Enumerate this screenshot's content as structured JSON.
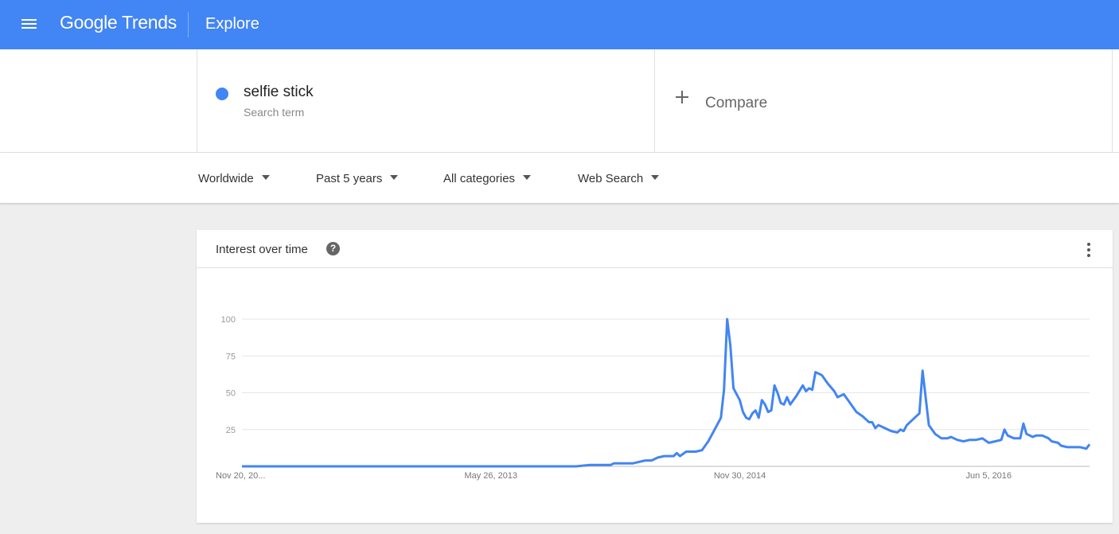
{
  "header": {
    "brand": "Google Trends",
    "section": "Explore"
  },
  "search": {
    "term": "selfie stick",
    "term_type": "Search term",
    "term_color": "#4285f4",
    "compare_label": "Compare"
  },
  "filters": {
    "region": "Worldwide",
    "time_range": "Past 5 years",
    "category": "All categories",
    "property": "Web Search"
  },
  "card": {
    "title": "Interest over time",
    "help_glyph": "?"
  },
  "colors": {
    "accent": "#4285f4"
  },
  "chart_data": {
    "type": "line",
    "title": "Interest over time",
    "xlabel": "",
    "ylabel": "",
    "ylim": [
      0,
      100
    ],
    "yticks": [
      25,
      50,
      75,
      100
    ],
    "x_range": [
      "2011-11-20",
      "2016-11-13"
    ],
    "xticks": [
      {
        "date": "2011-11-20",
        "label": "Nov 20, 20..."
      },
      {
        "date": "2013-05-26",
        "label": "May 26, 2013"
      },
      {
        "date": "2014-11-30",
        "label": "Nov 30, 2014"
      },
      {
        "date": "2016-06-05",
        "label": "Jun 5, 2016"
      }
    ],
    "grid": true,
    "legend": "none",
    "series": [
      {
        "color": "#4285f4",
        "points": [
          [
            "2011-11-20",
            0
          ],
          [
            "2012-06-01",
            0
          ],
          [
            "2013-01-01",
            0
          ],
          [
            "2013-06-01",
            0
          ],
          [
            "2013-12-01",
            0
          ],
          [
            "2014-01-01",
            1
          ],
          [
            "2014-02-16",
            1
          ],
          [
            "2014-02-23",
            2
          ],
          [
            "2014-04-06",
            2
          ],
          [
            "2014-04-20",
            3
          ],
          [
            "2014-05-04",
            4
          ],
          [
            "2014-05-18",
            4
          ],
          [
            "2014-06-01",
            6
          ],
          [
            "2014-06-15",
            7
          ],
          [
            "2014-07-06",
            7
          ],
          [
            "2014-07-13",
            9
          ],
          [
            "2014-07-20",
            7
          ],
          [
            "2014-08-03",
            10
          ],
          [
            "2014-08-24",
            10
          ],
          [
            "2014-09-07",
            11
          ],
          [
            "2014-09-21",
            17
          ],
          [
            "2014-10-05",
            25
          ],
          [
            "2014-10-19",
            33
          ],
          [
            "2014-10-26",
            52
          ],
          [
            "2014-11-02",
            100
          ],
          [
            "2014-11-09",
            82
          ],
          [
            "2014-11-16",
            53
          ],
          [
            "2014-11-30",
            45
          ],
          [
            "2014-12-07",
            37
          ],
          [
            "2014-12-14",
            33
          ],
          [
            "2014-12-21",
            32
          ],
          [
            "2014-12-28",
            36
          ],
          [
            "2015-01-04",
            38
          ],
          [
            "2015-01-11",
            33
          ],
          [
            "2015-01-18",
            45
          ],
          [
            "2015-01-25",
            42
          ],
          [
            "2015-02-01",
            37
          ],
          [
            "2015-02-08",
            38
          ],
          [
            "2015-02-15",
            55
          ],
          [
            "2015-02-22",
            50
          ],
          [
            "2015-03-01",
            43
          ],
          [
            "2015-03-08",
            42
          ],
          [
            "2015-03-15",
            47
          ],
          [
            "2015-03-22",
            42
          ],
          [
            "2015-04-05",
            48
          ],
          [
            "2015-04-19",
            55
          ],
          [
            "2015-04-26",
            51
          ],
          [
            "2015-05-03",
            53
          ],
          [
            "2015-05-10",
            52
          ],
          [
            "2015-05-17",
            64
          ],
          [
            "2015-05-31",
            62
          ],
          [
            "2015-06-14",
            56
          ],
          [
            "2015-06-28",
            51
          ],
          [
            "2015-07-05",
            47
          ],
          [
            "2015-07-19",
            49
          ],
          [
            "2015-08-02",
            43
          ],
          [
            "2015-08-16",
            37
          ],
          [
            "2015-08-30",
            34
          ],
          [
            "2015-09-13",
            30
          ],
          [
            "2015-09-20",
            30
          ],
          [
            "2015-09-27",
            26
          ],
          [
            "2015-10-04",
            28
          ],
          [
            "2015-10-18",
            26
          ],
          [
            "2015-11-01",
            24
          ],
          [
            "2015-11-15",
            23
          ],
          [
            "2015-11-22",
            25
          ],
          [
            "2015-11-29",
            24
          ],
          [
            "2015-12-06",
            28
          ],
          [
            "2015-12-20",
            32
          ],
          [
            "2016-01-03",
            36
          ],
          [
            "2016-01-10",
            65
          ],
          [
            "2016-01-24",
            28
          ],
          [
            "2016-02-07",
            22
          ],
          [
            "2016-02-21",
            19
          ],
          [
            "2016-03-06",
            19
          ],
          [
            "2016-03-13",
            20
          ],
          [
            "2016-03-27",
            18
          ],
          [
            "2016-04-10",
            17
          ],
          [
            "2016-04-24",
            18
          ],
          [
            "2016-05-08",
            18
          ],
          [
            "2016-05-22",
            19
          ],
          [
            "2016-06-05",
            16
          ],
          [
            "2016-06-19",
            17
          ],
          [
            "2016-07-03",
            18
          ],
          [
            "2016-07-10",
            25
          ],
          [
            "2016-07-17",
            21
          ],
          [
            "2016-07-31",
            19
          ],
          [
            "2016-08-14",
            19
          ],
          [
            "2016-08-21",
            29
          ],
          [
            "2016-08-28",
            22
          ],
          [
            "2016-09-11",
            20
          ],
          [
            "2016-09-18",
            21
          ],
          [
            "2016-10-02",
            21
          ],
          [
            "2016-10-16",
            19
          ],
          [
            "2016-10-23",
            17
          ],
          [
            "2016-11-06",
            16
          ],
          [
            "2016-11-13",
            14
          ],
          [
            "2016-11-27",
            13
          ],
          [
            "2016-12-11",
            13
          ],
          [
            "2016-12-25",
            13
          ],
          [
            "2017-01-08",
            12
          ],
          [
            "2017-01-15",
            15
          ]
        ]
      }
    ]
  }
}
